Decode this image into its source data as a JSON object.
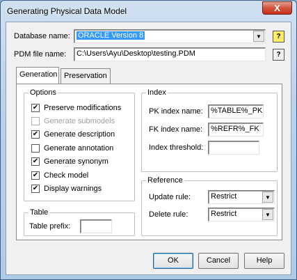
{
  "window": {
    "title": "Generating Physical Data Model",
    "close_glyph": "X"
  },
  "database": {
    "label": "Database name:",
    "value": "ORACLE Version 8",
    "help_glyph": "?"
  },
  "pdm_file": {
    "label": "PDM file name:",
    "value": "C:\\Users\\Ayu\\Desktop\\testing.PDM",
    "help_glyph": "?"
  },
  "tabs": [
    {
      "label": "Generation",
      "active": true
    },
    {
      "label": "Preservation",
      "active": false
    }
  ],
  "options": {
    "title": "Options",
    "items": [
      {
        "label": "Preserve modifications",
        "checked": true,
        "enabled": true
      },
      {
        "label": "Generate submodels",
        "checked": false,
        "enabled": false
      },
      {
        "label": "Generate description",
        "checked": true,
        "enabled": true
      },
      {
        "label": "Generate annotation",
        "checked": false,
        "enabled": true
      },
      {
        "label": "Generate synonym",
        "checked": true,
        "enabled": true
      },
      {
        "label": "Check model",
        "checked": true,
        "enabled": true
      },
      {
        "label": "Display warnings",
        "checked": true,
        "enabled": true
      }
    ],
    "check_glyph": "✔"
  },
  "table": {
    "title": "Table",
    "prefix_label": "Table prefix:",
    "prefix_value": ""
  },
  "index": {
    "title": "Index",
    "pk_label": "PK index name:",
    "pk_value": "%TABLE%_PK",
    "fk_label": "FK index name:",
    "fk_value": "%REFR%_FK",
    "threshold_label": "Index threshold:",
    "threshold_value": ""
  },
  "reference": {
    "title": "Reference",
    "update_label": "Update rule:",
    "update_value": "Restrict",
    "delete_label": "Delete rule:",
    "delete_value": "Restrict"
  },
  "buttons": {
    "ok": "OK",
    "cancel": "Cancel",
    "help": "Help"
  },
  "dropdown_arrow": "▼"
}
